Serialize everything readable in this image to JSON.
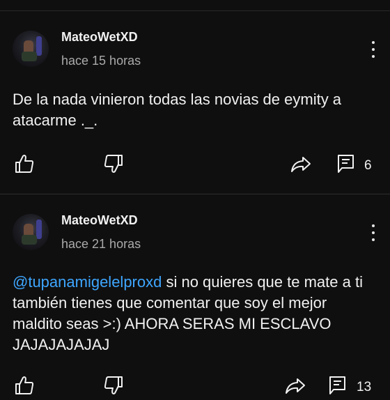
{
  "comments": [
    {
      "author": "MateoWetXD",
      "time": "hace 15 horas",
      "text": "De la nada vinieron todas las novias de eymity a atacarme ._.",
      "reply_count": "6"
    },
    {
      "author": "MateoWetXD",
      "time": "hace 21 horas",
      "mention": "@tupanamigelelproxd",
      "text": " si no quieres que te mate a ti también tienes que comentar que soy el mejor maldito seas >:) AHORA SERAS MI ESCLAVO JAJAJAJAJAJ",
      "reply_count": "13"
    }
  ],
  "colors": {
    "background": "#0f0f0f",
    "text": "#f1f1f1",
    "secondary_text": "#aaaaaa",
    "mention": "#3ea6ff"
  },
  "icons": {
    "like": "thumbs-up-icon",
    "dislike": "thumbs-down-icon",
    "share": "share-icon",
    "replies": "comment-icon",
    "menu": "more-vertical-icon"
  }
}
